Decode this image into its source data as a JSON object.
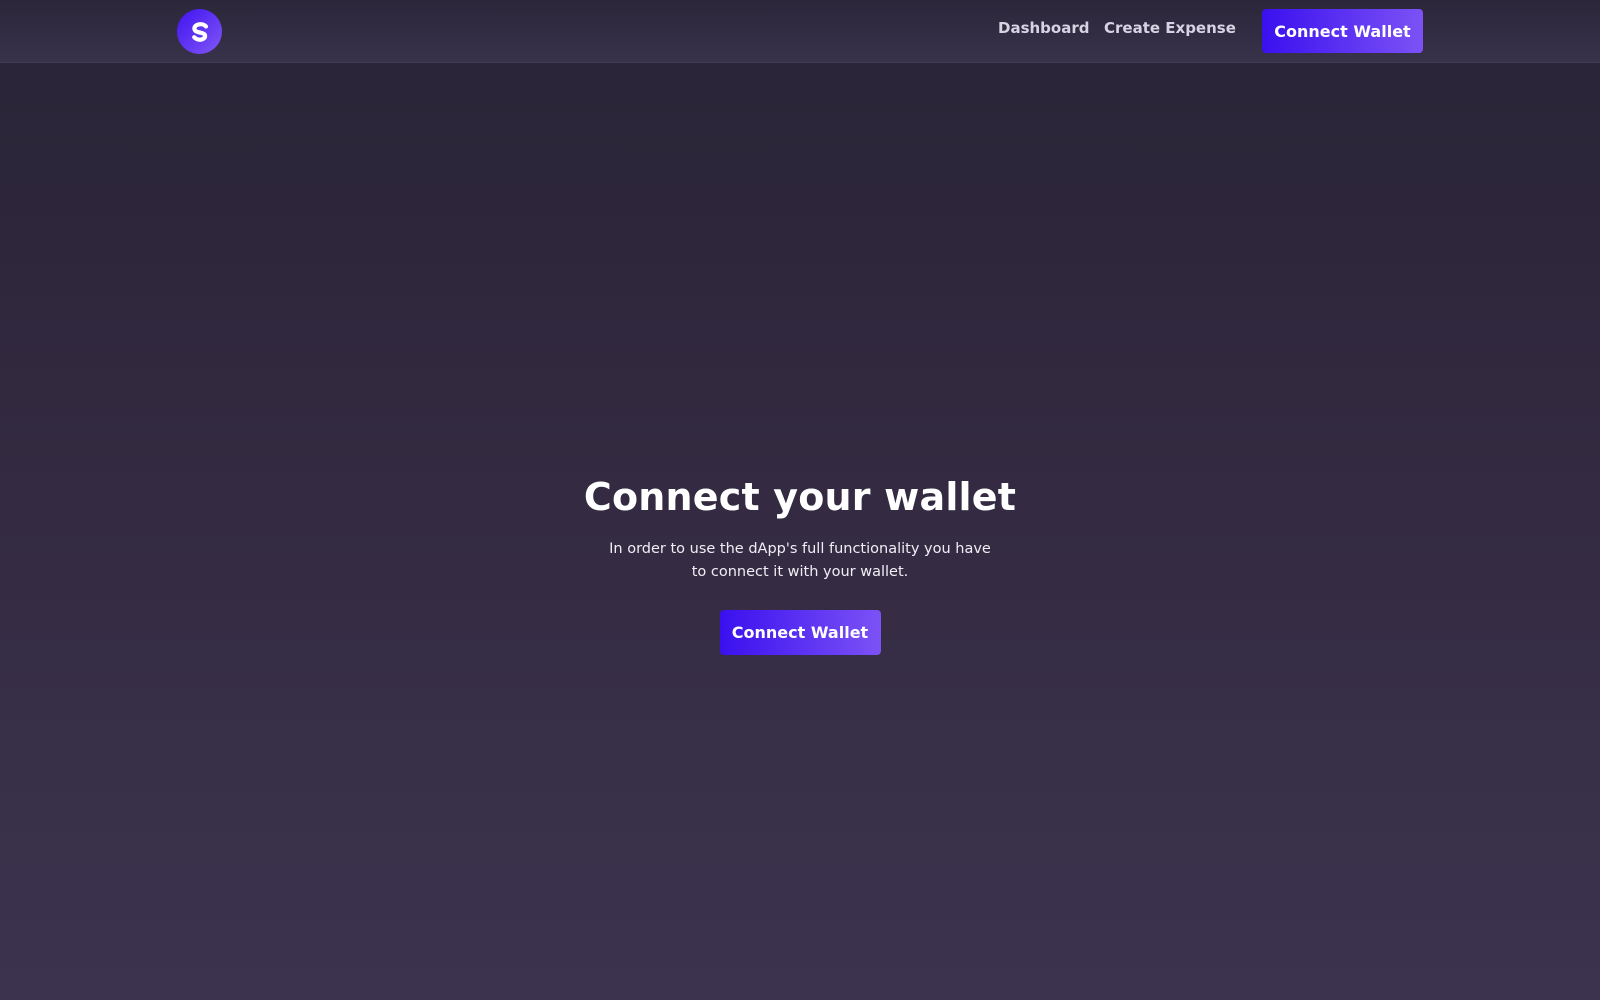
{
  "brand": {
    "logo_icon": "s-logo-icon",
    "accent_start": "#3a10ef",
    "accent_end": "#7c52f6"
  },
  "nav": {
    "links": [
      {
        "label": "Dashboard"
      },
      {
        "label": "Create Expense"
      }
    ],
    "connect_label": "Connect Wallet"
  },
  "hero": {
    "title": "Connect your wallet",
    "description": "In order to use the dApp's full functionality you have to connect it with your wallet.",
    "connect_label": "Connect Wallet"
  }
}
